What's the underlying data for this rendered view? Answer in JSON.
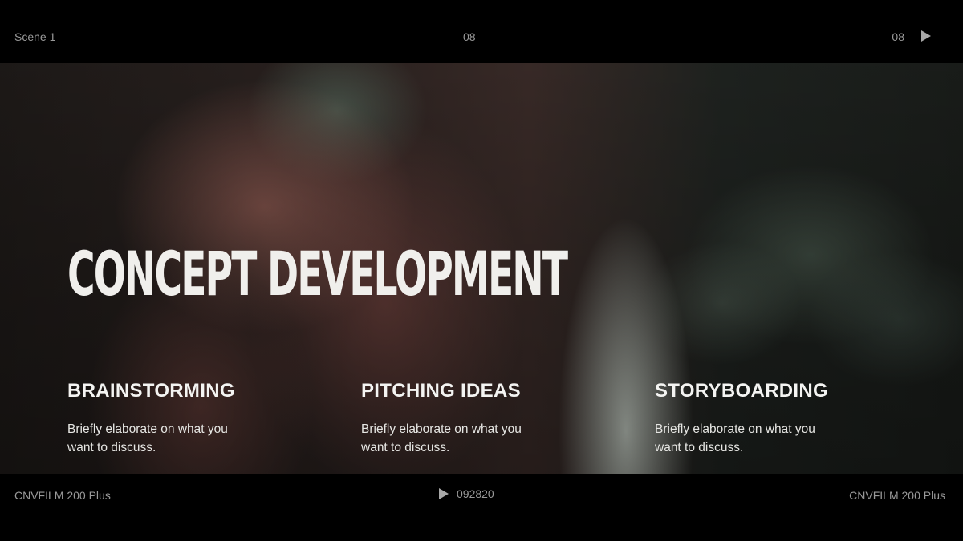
{
  "top_bar": {
    "scene_label": "Scene 1",
    "center_number": "08",
    "right_number": "08",
    "play_icon": "play-icon"
  },
  "title": "CONCEPT DEVELOPMENT",
  "columns": [
    {
      "heading": "BRAINSTORMING",
      "body": "Briefly elaborate on what you want to discuss."
    },
    {
      "heading": "PITCHING IDEAS",
      "body": "Briefly elaborate on what you want to discuss."
    },
    {
      "heading": "STORYBOARDING",
      "body": "Briefly elaborate on what you want to discuss."
    }
  ],
  "bottom_bar": {
    "left_label": "CNVFILM 200 Plus",
    "frame_number": "092820",
    "right_label": "CNVFILM 200 Plus",
    "play_icon": "play-icon"
  },
  "colors": {
    "bar_background": "#000000",
    "bar_text": "#9a9a9a",
    "title_text": "#f0efec",
    "body_text": "#e6e6e3"
  }
}
